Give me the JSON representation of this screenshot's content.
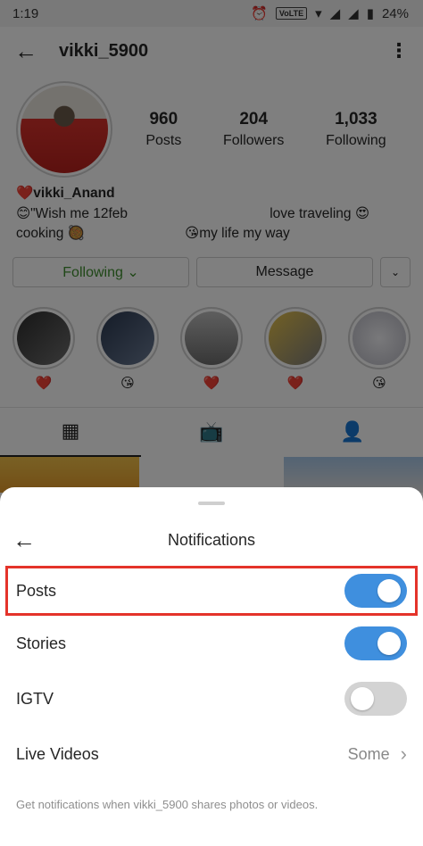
{
  "status_bar": {
    "time": "1:19",
    "network_badge": "VoLTE",
    "battery": "24%"
  },
  "header": {
    "back_icon": "arrow-left",
    "username": "vikki_5900",
    "menu_icon": "more-vertical"
  },
  "profile": {
    "posts": {
      "value": "960",
      "label": "Posts"
    },
    "followers": {
      "value": "204",
      "label": "Followers"
    },
    "following": {
      "value": "1,033",
      "label": "Following"
    }
  },
  "bio": {
    "name": "❤️vikki_Anand",
    "line1_left": "😊\"Wish me 12feb",
    "line1_right": "love traveling 😍",
    "line2_left": "cooking 🥘",
    "line2_right": "😘my life my way"
  },
  "actions": {
    "following": "Following ⌄",
    "message": "Message",
    "more": "⌄"
  },
  "highlights": [
    {
      "emoji": "❤️",
      "color": "#4a4a4a"
    },
    {
      "emoji": "😘",
      "color": "#3c4d66"
    },
    {
      "emoji": "❤️",
      "color": "#8a8a8a"
    },
    {
      "emoji": "❤️",
      "color": "#c9a94a"
    },
    {
      "emoji": "😘",
      "color": "#d4d4da"
    }
  ],
  "tabs": {
    "grid_icon": "grid",
    "igtv_icon": "tv",
    "tagged_icon": "person-tag"
  },
  "sheet": {
    "title": "Notifications",
    "back_icon": "arrow-left",
    "options": {
      "posts": {
        "label": "Posts",
        "state": "on"
      },
      "stories": {
        "label": "Stories",
        "state": "on"
      },
      "igtv": {
        "label": "IGTV",
        "state": "off"
      },
      "live": {
        "label": "Live Videos",
        "value": "Some"
      }
    },
    "footnote": "Get notifications when vikki_5900 shares photos or videos."
  },
  "colors": {
    "toggle_on": "#3f8fde",
    "toggle_off": "#d3d3d3",
    "highlight_border": "#e4332a",
    "following_text": "#3f8f2f"
  }
}
